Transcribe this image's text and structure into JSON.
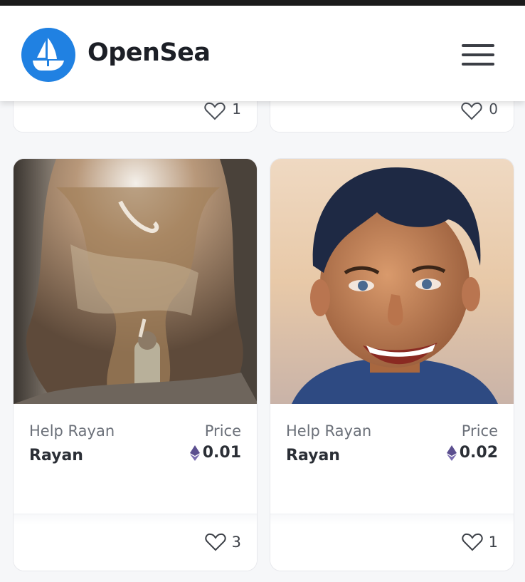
{
  "app": {
    "brand": "OpenSea",
    "brand_color": "#2081e2",
    "menu_icon": "hamburger-menu-icon"
  },
  "previous_row": [
    {
      "likes": "1"
    },
    {
      "likes": "0"
    }
  ],
  "cards": [
    {
      "collection": "Help Rayan",
      "name": "Rayan",
      "price_label": "Price",
      "price": "0.01",
      "currency_icon": "ethereum-icon",
      "likes": "3"
    },
    {
      "collection": "Help Rayan",
      "name": "Rayan",
      "price_label": "Price",
      "price": "0.02",
      "currency_icon": "ethereum-icon",
      "likes": "1"
    }
  ]
}
